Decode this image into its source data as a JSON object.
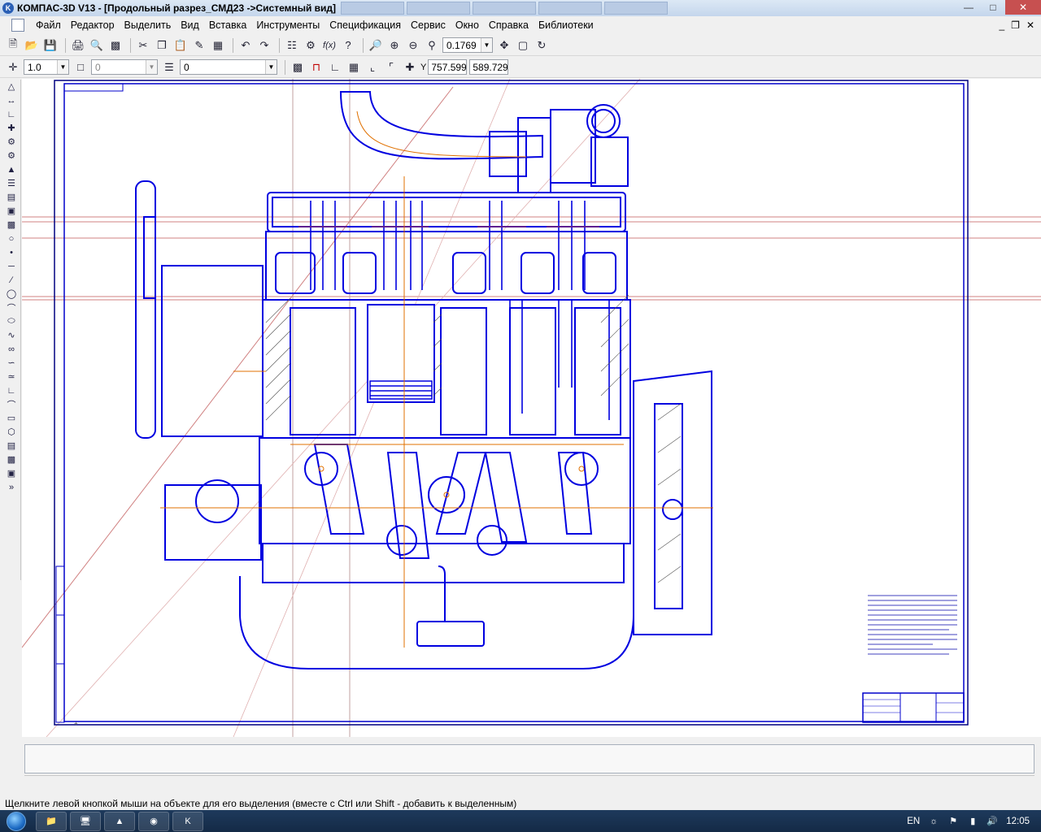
{
  "titlebar": {
    "title": "КОМПАС-3D V13 - [Продольный разрез_СМД23 ->Системный вид]",
    "task_thumbs": [
      "",
      "",
      "",
      "",
      "",
      ""
    ]
  },
  "menu": {
    "items": [
      "Файл",
      "Редактор",
      "Выделить",
      "Вид",
      "Вставка",
      "Инструменты",
      "Спецификация",
      "Сервис",
      "Окно",
      "Справка",
      "Библиотеки"
    ]
  },
  "toolbar1": {
    "zoom_value": "0.1769"
  },
  "toolbar2": {
    "line_scale": "1.0",
    "layer_value": "0",
    "style_value": "0",
    "coord_x": "757.599",
    "coord_y": "589.729",
    "coord_label": "Y"
  },
  "status": {
    "message": "Щелкните левой кнопкой мыши на объекте для его выделения (вместе с Ctrl или Shift - добавить к выделенным)"
  },
  "taskbar": {
    "lang": "EN",
    "clock": "12:05"
  },
  "colors": {
    "drawing_blue": "#0000e0",
    "axis_orange": "#e07000",
    "hatch_gray": "#555555",
    "frame_blue": "#0000cc"
  }
}
